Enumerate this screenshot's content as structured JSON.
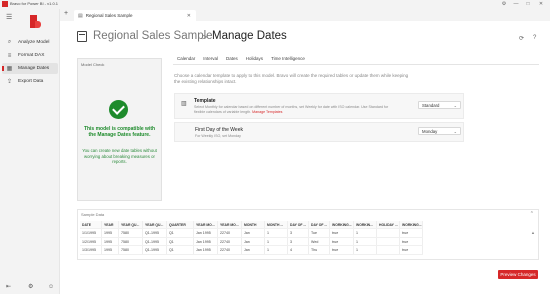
{
  "app": {
    "title": "Bravo for Power BI - v1.0.1",
    "window_controls": [
      "⚙",
      "—",
      "□",
      "✕"
    ]
  },
  "sidebar": {
    "items": [
      {
        "label": "Analyze Model",
        "icon": "analyze-icon"
      },
      {
        "label": "Format DAX",
        "icon": "format-dax-icon"
      },
      {
        "label": "Manage Dates",
        "icon": "calendar-icon",
        "active": true
      },
      {
        "label": "Export Data",
        "icon": "export-icon"
      }
    ]
  },
  "tabs": {
    "new_tab_label": "+",
    "document_tab": "Regional Sales Sample"
  },
  "header": {
    "breadcrumb_root": "Regional Sales Sample",
    "breadcrumb_separator": ">",
    "breadcrumb_current": "Manage Dates"
  },
  "model_check": {
    "title": "Model Check",
    "headline": "This model is compatible with the Manage Dates feature.",
    "description": "You can create new date tables without worrying about breaking measures or reports."
  },
  "content_tabs": [
    "Calendar",
    "Interval",
    "Dates",
    "Holidays",
    "Time Intelligence"
  ],
  "intro": "Choose a calendar template to apply to this model. Bravo will create the required tables or update them while keeping the existing relationships intact.",
  "template": {
    "title": "Template",
    "description": "Select Monthly for calendar based on different number of months, set Weekly for date with ISO calendar. Use Standard for flexible calendars of variable length.",
    "link": "Manage Templates",
    "value": "Standard"
  },
  "first_day": {
    "title": "First Day of the Week",
    "description": "For Weekly ISO, set Monday",
    "value": "Monday"
  },
  "sample": {
    "title": "Sample Data",
    "columns": [
      "DATE",
      "YEAR",
      "YEAR QU...",
      "YEAR QU...",
      "QUARTER",
      "YEAR MO...",
      "YEAR MO...",
      "MONTH",
      "MONTH ...",
      "DAY OF ...",
      "DAY OF ...",
      "WORKING...",
      "WORKIN...",
      "HOLIDAY ...",
      "WORKING..."
    ],
    "rows": [
      [
        "1/1/1995",
        "1995",
        "7580",
        "Q1-1995",
        "Q1",
        "Jan 1995",
        "22740",
        "Jan",
        "1",
        "3",
        "Tue",
        "true",
        "1",
        "",
        "true"
      ],
      [
        "1/2/1995",
        "1995",
        "7580",
        "Q1-1995",
        "Q1",
        "Jan 1995",
        "22740",
        "Jan",
        "1",
        "3",
        "Wed",
        "true",
        "1",
        "",
        "true"
      ],
      [
        "1/3/1995",
        "1995",
        "7580",
        "Q1-1995",
        "Q1",
        "Jan 1995",
        "22740",
        "Jan",
        "1",
        "4",
        "Thu",
        "true",
        "1",
        "",
        "true"
      ]
    ]
  },
  "actions": {
    "preview": "Preview Changes"
  }
}
